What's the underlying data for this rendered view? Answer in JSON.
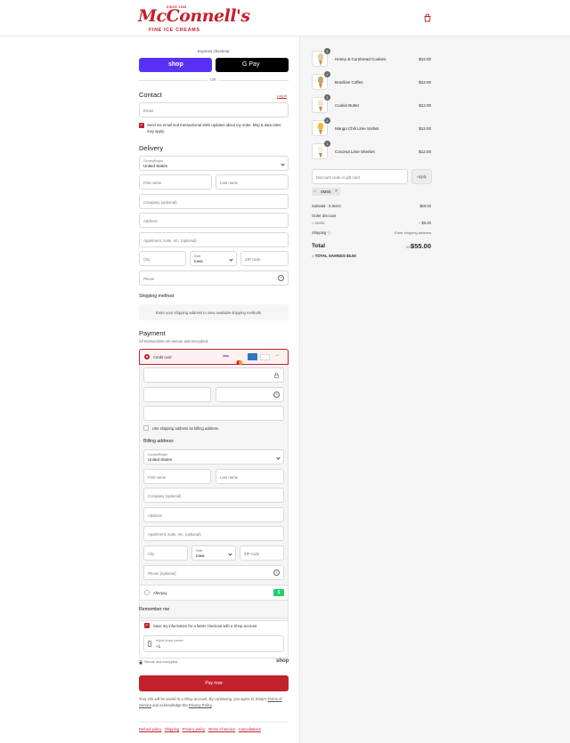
{
  "brand": {
    "since": "SINCE 1949",
    "name": "McConnell's",
    "tagline": "FINE ICE CREAMS"
  },
  "express": {
    "title": "Express checkout",
    "shop_label": "shop",
    "gpay_label": "G Pay",
    "or_label": "OR"
  },
  "contact": {
    "heading": "Contact",
    "login_label": "Log in",
    "email_placeholder": "Email",
    "marketing_label": "Send me email and transactional SMS updates about my order. Msg & data rates may apply."
  },
  "delivery": {
    "heading": "Delivery",
    "country_label": "Country/Region",
    "country_value": "United States",
    "first_name": "First name",
    "last_name": "Last name",
    "company": "Company (optional)",
    "address": "Address",
    "apartment": "Apartment, suite, etc. (optional)",
    "city": "City",
    "state_label": "State",
    "state_value": "Iowa",
    "zip": "ZIP code",
    "phone": "Phone"
  },
  "shipping": {
    "heading": "Shipping method",
    "notice": "Enter your shipping address to view available shipping methods."
  },
  "payment": {
    "heading": "Payment",
    "subtitle": "All transactions are secure and encrypted.",
    "credit_card": "Credit card",
    "card_logos": [
      "VISA",
      "MC",
      "AMEX",
      "DISC"
    ],
    "use_shipping": "Use shipping address as billing address.",
    "afterpay": "Afterpay",
    "afterpay_badge": "$"
  },
  "billing": {
    "heading": "Billing address",
    "country_label": "Country/Region",
    "country_value": "United States",
    "first_name": "First name",
    "last_name": "Last name",
    "company": "Company (optional)",
    "address": "Address",
    "apartment": "Apartment, suite, etc. (optional)",
    "city": "City",
    "state_label": "State",
    "state_value": "Iowa",
    "zip": "ZIP code",
    "phone": "Phone (optional)"
  },
  "remember": {
    "heading": "Remember me",
    "save_label": "Save my information for a faster checkout with a Shop account",
    "phone_label": "Mobile phone number",
    "phone_value": "+1",
    "secure": "Secure and encrypted",
    "shop": "shop"
  },
  "pay_now": "Pay now",
  "legal": {
    "text1": "Your info will be saved to a Shop account. By continuing, you agree to Shop's",
    "terms": "Terms of Service",
    "and": "and acknowledge the",
    "privacy": "Privacy Policy",
    "period": "."
  },
  "footer_links": [
    "Refund policy",
    "Shipping",
    "Privacy policy",
    "Terms of service",
    "Cancellations"
  ],
  "items": [
    {
      "qty": "1",
      "name": "Honey & Cornbread Cookies",
      "price": "$12.00"
    },
    {
      "qty": "1",
      "name": "Brazilian Coffee",
      "price": "$12.00"
    },
    {
      "qty": "1",
      "name": "Cookie Butter",
      "price": "$12.00"
    },
    {
      "qty": "1",
      "name": "Mango Chili Lime Sorbet",
      "price": "$12.00"
    },
    {
      "qty": "1",
      "name": "Coconut Lime Sherbet",
      "price": "$12.00"
    }
  ],
  "discount": {
    "placeholder": "Discount code or gift card",
    "apply": "Apply",
    "code": "SMS5"
  },
  "summary": {
    "subtotal_label": "Subtotal · 5 items",
    "subtotal": "$60.00",
    "order_discount": "Order discount",
    "code": "SMS5",
    "discount_value": "− $5.00",
    "shipping_label": "Shipping",
    "shipping_value": "Enter shipping address",
    "total_label": "Total",
    "currency": "USD",
    "total": "$55.00",
    "savings": "TOTAL SAVINGS  $5.00"
  },
  "colors": {
    "brand_red": "#c3202d",
    "shop_purple": "#5a31f4",
    "afterpay_green": "#1fd16b"
  }
}
